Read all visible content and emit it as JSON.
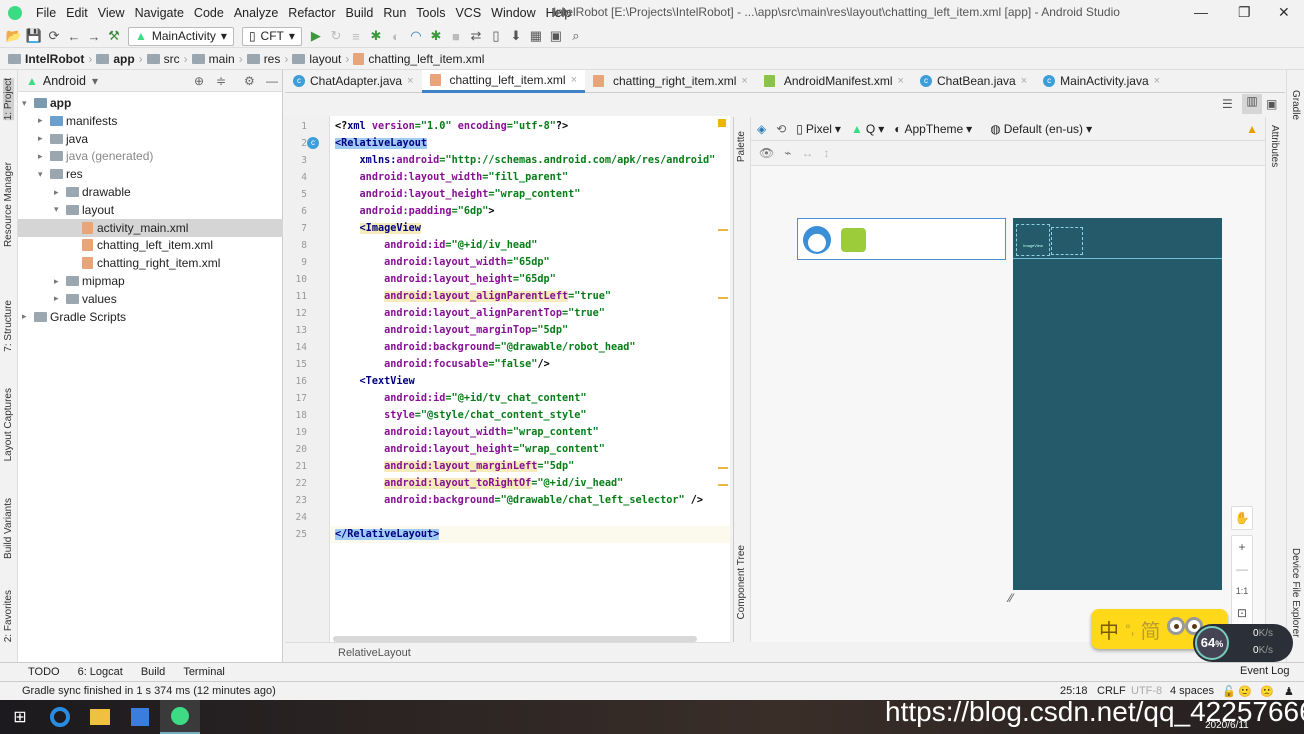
{
  "window": {
    "title": "IntelRobot [E:\\Projects\\IntelRobot] - ...\\app\\src\\main\\res\\layout\\chatting_left_item.xml [app] - Android Studio",
    "minimize": "—",
    "maximize": "❐",
    "close": "✕"
  },
  "menu": [
    "File",
    "Edit",
    "View",
    "Navigate",
    "Code",
    "Analyze",
    "Refactor",
    "Build",
    "Run",
    "Tools",
    "VCS",
    "Window",
    "Help"
  ],
  "toolbar": {
    "run_config": "MainActivity",
    "device": "CFT"
  },
  "breadcrumb": [
    "IntelRobot",
    "app",
    "src",
    "main",
    "res",
    "layout",
    "chatting_left_item.xml"
  ],
  "left_strip": [
    "1: Project",
    "Resource Manager",
    "7: Structure",
    "Layout Captures",
    "Build Variants",
    "2: Favorites"
  ],
  "project": {
    "view": "Android",
    "tree": [
      {
        "label": "app",
        "depth": 0,
        "arrow": "▾",
        "kind": "module",
        "bold": true
      },
      {
        "label": "manifests",
        "depth": 1,
        "arrow": "▸",
        "kind": "folder"
      },
      {
        "label": "java",
        "depth": 1,
        "arrow": "▸",
        "kind": "folder"
      },
      {
        "label": "java (generated)",
        "depth": 1,
        "arrow": "▸",
        "kind": "folder"
      },
      {
        "label": "res",
        "depth": 1,
        "arrow": "▾",
        "kind": "folder"
      },
      {
        "label": "drawable",
        "depth": 2,
        "arrow": "▸",
        "kind": "folder"
      },
      {
        "label": "layout",
        "depth": 2,
        "arrow": "▾",
        "kind": "folder"
      },
      {
        "label": "activity_main.xml",
        "depth": 3,
        "arrow": "",
        "kind": "xml",
        "selected": true
      },
      {
        "label": "chatting_left_item.xml",
        "depth": 3,
        "arrow": "",
        "kind": "xml"
      },
      {
        "label": "chatting_right_item.xml",
        "depth": 3,
        "arrow": "",
        "kind": "xml"
      },
      {
        "label": "mipmap",
        "depth": 2,
        "arrow": "▸",
        "kind": "folder"
      },
      {
        "label": "values",
        "depth": 2,
        "arrow": "▸",
        "kind": "folder"
      },
      {
        "label": "Gradle Scripts",
        "depth": 0,
        "arrow": "▸",
        "kind": "gradle"
      }
    ]
  },
  "tabs": [
    {
      "label": "ChatAdapter.java",
      "icon": "class"
    },
    {
      "label": "chatting_left_item.xml",
      "icon": "xml",
      "active": true
    },
    {
      "label": "chatting_right_item.xml",
      "icon": "xml"
    },
    {
      "label": "AndroidManifest.xml",
      "icon": "manifest"
    },
    {
      "label": "ChatBean.java",
      "icon": "class"
    },
    {
      "label": "MainActivity.java",
      "icon": "class"
    }
  ],
  "code": [
    [
      [
        "pl",
        "<?"
      ],
      [
        "tag",
        "xml "
      ],
      [
        "ns",
        "version"
      ],
      [
        "val",
        "=\"1.0\" "
      ],
      [
        "ns",
        "encoding"
      ],
      [
        "val",
        "=\"utf-8\""
      ],
      [
        "pl",
        "?>"
      ]
    ],
    [
      [
        "tag tagsel",
        "<RelativeLayout"
      ]
    ],
    [
      [
        "pl",
        "    "
      ],
      [
        "tag",
        "xmlns:"
      ],
      [
        "ns",
        "android"
      ],
      [
        "val",
        "=\"http://schemas.android.com/apk/res/android\""
      ]
    ],
    [
      [
        "pl",
        "    "
      ],
      [
        "ns",
        "android:layout_width"
      ],
      [
        "val",
        "=\"fill_parent\""
      ]
    ],
    [
      [
        "pl",
        "    "
      ],
      [
        "ns",
        "android:layout_height"
      ],
      [
        "val",
        "=\"wrap_content\""
      ]
    ],
    [
      [
        "pl",
        "    "
      ],
      [
        "ns",
        "android:padding"
      ],
      [
        "val",
        "=\"6dp\""
      ],
      [
        "pl",
        ">"
      ]
    ],
    [
      [
        "pl",
        "    "
      ],
      [
        "tag hl",
        "<ImageView"
      ]
    ],
    [
      [
        "pl",
        "        "
      ],
      [
        "ns",
        "android:id"
      ],
      [
        "val",
        "=\"@+id/iv_head\""
      ]
    ],
    [
      [
        "pl",
        "        "
      ],
      [
        "ns",
        "android:layout_width"
      ],
      [
        "val",
        "=\"65dp\""
      ]
    ],
    [
      [
        "pl",
        "        "
      ],
      [
        "ns",
        "android:layout_height"
      ],
      [
        "val",
        "=\"65dp\""
      ]
    ],
    [
      [
        "pl",
        "        "
      ],
      [
        "ns hl",
        "android:layout_alignParentLeft"
      ],
      [
        "val",
        "=\"true\""
      ]
    ],
    [
      [
        "pl",
        "        "
      ],
      [
        "ns",
        "android:layout_alignParentTop"
      ],
      [
        "val",
        "=\"true\""
      ]
    ],
    [
      [
        "pl",
        "        "
      ],
      [
        "ns",
        "android:layout_marginTop"
      ],
      [
        "val",
        "=\"5dp\""
      ]
    ],
    [
      [
        "pl",
        "        "
      ],
      [
        "ns",
        "android:background"
      ],
      [
        "val",
        "=\"@drawable/robot_head\""
      ]
    ],
    [
      [
        "pl",
        "        "
      ],
      [
        "ns",
        "android:focusable"
      ],
      [
        "val",
        "=\"false\""
      ],
      [
        "pl",
        "/>"
      ]
    ],
    [
      [
        "pl",
        "    "
      ],
      [
        "tag",
        "<TextView"
      ]
    ],
    [
      [
        "pl",
        "        "
      ],
      [
        "ns",
        "android:id"
      ],
      [
        "val",
        "=\"@+id/tv_chat_content\""
      ]
    ],
    [
      [
        "pl",
        "        "
      ],
      [
        "ns",
        "style"
      ],
      [
        "val",
        "=\"@style/chat_content_style\""
      ]
    ],
    [
      [
        "pl",
        "        "
      ],
      [
        "ns",
        "android:layout_width"
      ],
      [
        "val",
        "=\"wrap_content\""
      ]
    ],
    [
      [
        "pl",
        "        "
      ],
      [
        "ns",
        "android:layout_height"
      ],
      [
        "val",
        "=\"wrap_content\""
      ]
    ],
    [
      [
        "pl",
        "        "
      ],
      [
        "ns hl",
        "android:layout_marginLeft"
      ],
      [
        "val",
        "=\"5dp\""
      ]
    ],
    [
      [
        "pl",
        "        "
      ],
      [
        "ns hl",
        "android:layout_toRightOf"
      ],
      [
        "val",
        "=\"@+id/iv_head\""
      ]
    ],
    [
      [
        "pl",
        "        "
      ],
      [
        "ns",
        "android:background"
      ],
      [
        "val",
        "=\"@drawable/chat_left_selector\""
      ],
      [
        "pl",
        " />"
      ]
    ],
    [],
    [
      [
        "tag tagsel",
        "</RelativeLayout>"
      ]
    ]
  ],
  "editor_footer": "RelativeLayout",
  "design": {
    "palette": "Palette",
    "component_tree": "Component Tree",
    "attributes": "Attributes",
    "device": "Pixel",
    "api": "Q",
    "theme": "AppTheme",
    "locale": "Default (en-us)",
    "blueprint_label": "ImageView",
    "zoom_fit": "1:1",
    "zoom_in": "+",
    "zoom_out": "—"
  },
  "right_strip": [
    "Gradle",
    "Device File Explorer"
  ],
  "bottom_tools": [
    "TODO",
    "6: Logcat",
    "Build",
    "Terminal",
    "Event Log"
  ],
  "status": {
    "message": "Gradle sync finished in 1 s 374 ms (12 minutes ago)",
    "position": "25:18",
    "line_sep": "CRLF",
    "encoding": "UTF-8",
    "indent": "4 spaces"
  },
  "ime": {
    "lang": "中",
    "punct": "°,",
    "mode": "简"
  },
  "net": {
    "percent": "64",
    "unit": "%",
    "up": "0",
    "down": "0",
    "rate_unit": "K/s"
  },
  "watermark": "https://blog.csdn.net/qq_42257666",
  "clock": {
    "date": "2020/6/11"
  },
  "colors": {
    "accent": "#4083c9",
    "blueprint": "#245a6a",
    "ime": "#ffd81a"
  }
}
